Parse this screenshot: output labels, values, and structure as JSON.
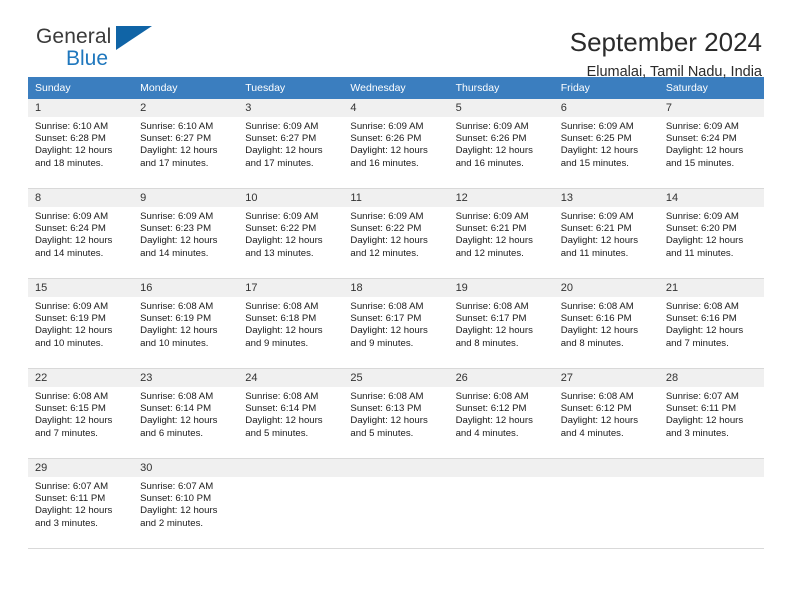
{
  "logo": {
    "word_one": "General",
    "word_two": "Blue",
    "triangle_icon": "blue-triangle-icon",
    "colors": {
      "general": "#3a3a3a",
      "blue": "#1f77bd",
      "triangle": "#1064a6"
    }
  },
  "header": {
    "title": "September 2024",
    "location": "Elumalai, Tamil Nadu, India"
  },
  "theme": {
    "header_row_bg": "#3b7ebf",
    "header_row_text": "#ffffff",
    "daynum_bg": "#f0f0f0",
    "row_divider": "#3b7ebf",
    "cell_border": "#d9d9d9"
  },
  "calendar": {
    "weekday_headers": [
      "Sunday",
      "Monday",
      "Tuesday",
      "Wednesday",
      "Thursday",
      "Friday",
      "Saturday"
    ],
    "weeks": [
      [
        {
          "day": "1",
          "sunrise": "Sunrise: 6:10 AM",
          "sunset": "Sunset: 6:28 PM",
          "daylight_line1": "Daylight: 12 hours",
          "daylight_line2": "and 18 minutes."
        },
        {
          "day": "2",
          "sunrise": "Sunrise: 6:10 AM",
          "sunset": "Sunset: 6:27 PM",
          "daylight_line1": "Daylight: 12 hours",
          "daylight_line2": "and 17 minutes."
        },
        {
          "day": "3",
          "sunrise": "Sunrise: 6:09 AM",
          "sunset": "Sunset: 6:27 PM",
          "daylight_line1": "Daylight: 12 hours",
          "daylight_line2": "and 17 minutes."
        },
        {
          "day": "4",
          "sunrise": "Sunrise: 6:09 AM",
          "sunset": "Sunset: 6:26 PM",
          "daylight_line1": "Daylight: 12 hours",
          "daylight_line2": "and 16 minutes."
        },
        {
          "day": "5",
          "sunrise": "Sunrise: 6:09 AM",
          "sunset": "Sunset: 6:26 PM",
          "daylight_line1": "Daylight: 12 hours",
          "daylight_line2": "and 16 minutes."
        },
        {
          "day": "6",
          "sunrise": "Sunrise: 6:09 AM",
          "sunset": "Sunset: 6:25 PM",
          "daylight_line1": "Daylight: 12 hours",
          "daylight_line2": "and 15 minutes."
        },
        {
          "day": "7",
          "sunrise": "Sunrise: 6:09 AM",
          "sunset": "Sunset: 6:24 PM",
          "daylight_line1": "Daylight: 12 hours",
          "daylight_line2": "and 15 minutes."
        }
      ],
      [
        {
          "day": "8",
          "sunrise": "Sunrise: 6:09 AM",
          "sunset": "Sunset: 6:24 PM",
          "daylight_line1": "Daylight: 12 hours",
          "daylight_line2": "and 14 minutes."
        },
        {
          "day": "9",
          "sunrise": "Sunrise: 6:09 AM",
          "sunset": "Sunset: 6:23 PM",
          "daylight_line1": "Daylight: 12 hours",
          "daylight_line2": "and 14 minutes."
        },
        {
          "day": "10",
          "sunrise": "Sunrise: 6:09 AM",
          "sunset": "Sunset: 6:22 PM",
          "daylight_line1": "Daylight: 12 hours",
          "daylight_line2": "and 13 minutes."
        },
        {
          "day": "11",
          "sunrise": "Sunrise: 6:09 AM",
          "sunset": "Sunset: 6:22 PM",
          "daylight_line1": "Daylight: 12 hours",
          "daylight_line2": "and 12 minutes."
        },
        {
          "day": "12",
          "sunrise": "Sunrise: 6:09 AM",
          "sunset": "Sunset: 6:21 PM",
          "daylight_line1": "Daylight: 12 hours",
          "daylight_line2": "and 12 minutes."
        },
        {
          "day": "13",
          "sunrise": "Sunrise: 6:09 AM",
          "sunset": "Sunset: 6:21 PM",
          "daylight_line1": "Daylight: 12 hours",
          "daylight_line2": "and 11 minutes."
        },
        {
          "day": "14",
          "sunrise": "Sunrise: 6:09 AM",
          "sunset": "Sunset: 6:20 PM",
          "daylight_line1": "Daylight: 12 hours",
          "daylight_line2": "and 11 minutes."
        }
      ],
      [
        {
          "day": "15",
          "sunrise": "Sunrise: 6:09 AM",
          "sunset": "Sunset: 6:19 PM",
          "daylight_line1": "Daylight: 12 hours",
          "daylight_line2": "and 10 minutes."
        },
        {
          "day": "16",
          "sunrise": "Sunrise: 6:08 AM",
          "sunset": "Sunset: 6:19 PM",
          "daylight_line1": "Daylight: 12 hours",
          "daylight_line2": "and 10 minutes."
        },
        {
          "day": "17",
          "sunrise": "Sunrise: 6:08 AM",
          "sunset": "Sunset: 6:18 PM",
          "daylight_line1": "Daylight: 12 hours",
          "daylight_line2": "and 9 minutes."
        },
        {
          "day": "18",
          "sunrise": "Sunrise: 6:08 AM",
          "sunset": "Sunset: 6:17 PM",
          "daylight_line1": "Daylight: 12 hours",
          "daylight_line2": "and 9 minutes."
        },
        {
          "day": "19",
          "sunrise": "Sunrise: 6:08 AM",
          "sunset": "Sunset: 6:17 PM",
          "daylight_line1": "Daylight: 12 hours",
          "daylight_line2": "and 8 minutes."
        },
        {
          "day": "20",
          "sunrise": "Sunrise: 6:08 AM",
          "sunset": "Sunset: 6:16 PM",
          "daylight_line1": "Daylight: 12 hours",
          "daylight_line2": "and 8 minutes."
        },
        {
          "day": "21",
          "sunrise": "Sunrise: 6:08 AM",
          "sunset": "Sunset: 6:16 PM",
          "daylight_line1": "Daylight: 12 hours",
          "daylight_line2": "and 7 minutes."
        }
      ],
      [
        {
          "day": "22",
          "sunrise": "Sunrise: 6:08 AM",
          "sunset": "Sunset: 6:15 PM",
          "daylight_line1": "Daylight: 12 hours",
          "daylight_line2": "and 7 minutes."
        },
        {
          "day": "23",
          "sunrise": "Sunrise: 6:08 AM",
          "sunset": "Sunset: 6:14 PM",
          "daylight_line1": "Daylight: 12 hours",
          "daylight_line2": "and 6 minutes."
        },
        {
          "day": "24",
          "sunrise": "Sunrise: 6:08 AM",
          "sunset": "Sunset: 6:14 PM",
          "daylight_line1": "Daylight: 12 hours",
          "daylight_line2": "and 5 minutes."
        },
        {
          "day": "25",
          "sunrise": "Sunrise: 6:08 AM",
          "sunset": "Sunset: 6:13 PM",
          "daylight_line1": "Daylight: 12 hours",
          "daylight_line2": "and 5 minutes."
        },
        {
          "day": "26",
          "sunrise": "Sunrise: 6:08 AM",
          "sunset": "Sunset: 6:12 PM",
          "daylight_line1": "Daylight: 12 hours",
          "daylight_line2": "and 4 minutes."
        },
        {
          "day": "27",
          "sunrise": "Sunrise: 6:08 AM",
          "sunset": "Sunset: 6:12 PM",
          "daylight_line1": "Daylight: 12 hours",
          "daylight_line2": "and 4 minutes."
        },
        {
          "day": "28",
          "sunrise": "Sunrise: 6:07 AM",
          "sunset": "Sunset: 6:11 PM",
          "daylight_line1": "Daylight: 12 hours",
          "daylight_line2": "and 3 minutes."
        }
      ],
      [
        {
          "day": "29",
          "sunrise": "Sunrise: 6:07 AM",
          "sunset": "Sunset: 6:11 PM",
          "daylight_line1": "Daylight: 12 hours",
          "daylight_line2": "and 3 minutes."
        },
        {
          "day": "30",
          "sunrise": "Sunrise: 6:07 AM",
          "sunset": "Sunset: 6:10 PM",
          "daylight_line1": "Daylight: 12 hours",
          "daylight_line2": "and 2 minutes."
        },
        {
          "day": "",
          "sunrise": "",
          "sunset": "",
          "daylight_line1": "",
          "daylight_line2": ""
        },
        {
          "day": "",
          "sunrise": "",
          "sunset": "",
          "daylight_line1": "",
          "daylight_line2": ""
        },
        {
          "day": "",
          "sunrise": "",
          "sunset": "",
          "daylight_line1": "",
          "daylight_line2": ""
        },
        {
          "day": "",
          "sunrise": "",
          "sunset": "",
          "daylight_line1": "",
          "daylight_line2": ""
        },
        {
          "day": "",
          "sunrise": "",
          "sunset": "",
          "daylight_line1": "",
          "daylight_line2": ""
        }
      ]
    ]
  }
}
